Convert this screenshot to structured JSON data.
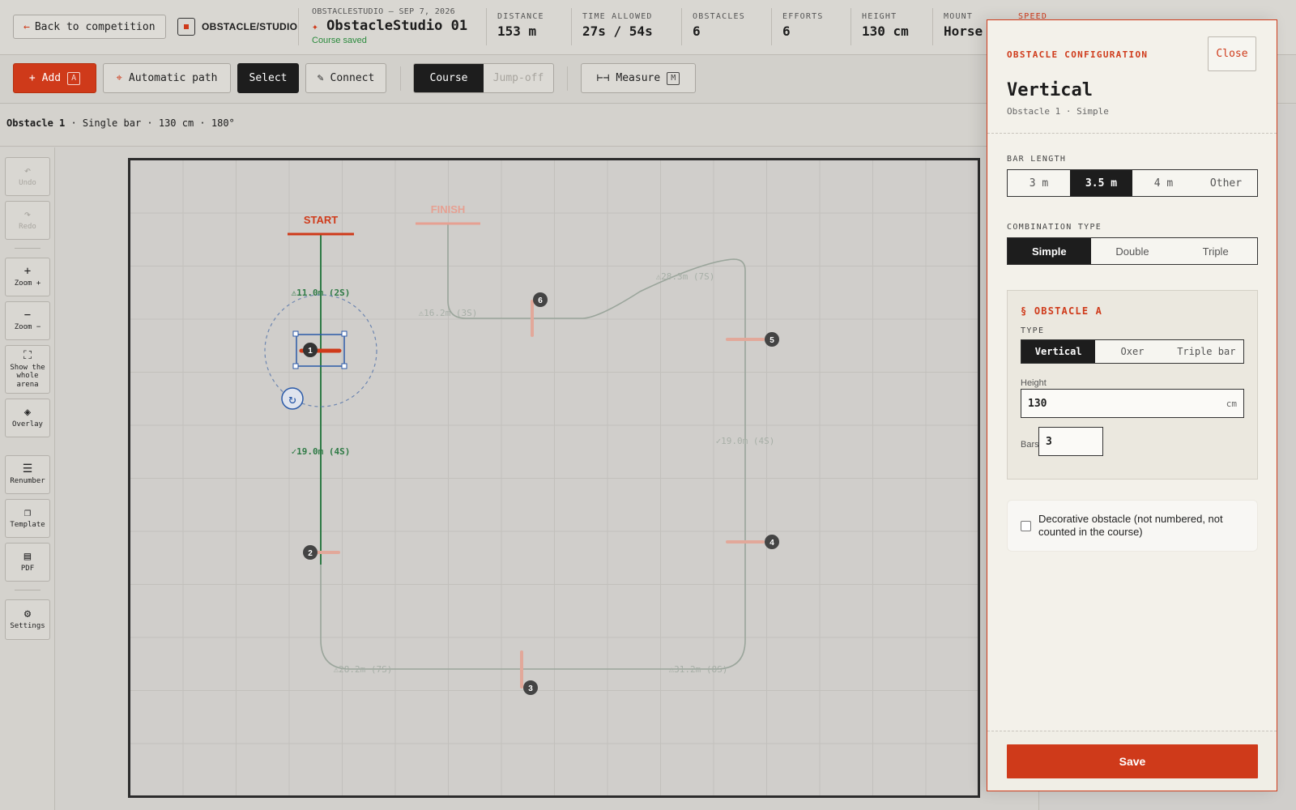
{
  "topbar": {
    "back_label": "Back to competition",
    "brand": "OBSTACLE/STUDIO",
    "course_kicker": "OBSTACLESTUDIO — SEP 7, 2026",
    "course_name": "ObstacleStudio 01",
    "course_status": "Course saved",
    "stats": [
      {
        "label": "DISTANCE",
        "value": "153 m"
      },
      {
        "label": "TIME ALLOWED",
        "value": "27s / 54s"
      },
      {
        "label": "OBSTACLES",
        "value": "6"
      },
      {
        "label": "EFFORTS",
        "value": "6"
      },
      {
        "label": "HEIGHT",
        "value": "130 cm"
      },
      {
        "label": "MOUNT",
        "value": "Horse"
      },
      {
        "label": "SPEED",
        "value": ""
      }
    ]
  },
  "toolbar": {
    "add_label": "Add",
    "add_key": "A",
    "auto_path_label": "Automatic path",
    "select_label": "Select",
    "connect_label": "Connect",
    "course_tab": "Course",
    "jumpoff_tab": "Jump-off",
    "measure_label": "Measure",
    "measure_key": "M"
  },
  "infobar": {
    "obstacle": "Obstacle 1",
    "details": " · Single bar · 130 cm · 180°"
  },
  "rail": {
    "undo": "Undo",
    "redo": "Redo",
    "zoom_in": "Zoom +",
    "zoom_out": "Zoom −",
    "show_arena": "Show the whole arena",
    "overlay": "Overlay",
    "renumber": "Renumber",
    "template": "Template",
    "pdf": "PDF",
    "settings": "Settings"
  },
  "arena": {
    "start_label": "START",
    "finish_label": "FINISH",
    "segments": [
      "⚠11.0m (2S)",
      "✓19.0m (4S)",
      "⚠28.2m (7S)",
      "⚠31.2m (8S)",
      "✓19.0m (4S)",
      "⚠28.3m (7S)",
      "⚠16.2m (3S)"
    ],
    "obstacles": [
      "1",
      "2",
      "3",
      "4",
      "5",
      "6"
    ]
  },
  "modal": {
    "kicker": "OBSTACLE CONFIGURATION",
    "close_label": "Close",
    "title": "Vertical",
    "subtitle": "Obstacle 1 · Simple",
    "bar_length_label": "BAR LENGTH",
    "bar_lengths": [
      "3 m",
      "3.5 m",
      "4 m",
      "Other"
    ],
    "bar_length_selected": "3.5 m",
    "combination_label": "COMBINATION TYPE",
    "combinations": [
      "Simple",
      "Double",
      "Triple"
    ],
    "combination_selected": "Simple",
    "obstacle_a_title": "§ OBSTACLE A",
    "type_label": "TYPE",
    "types": [
      "Vertical",
      "Oxer",
      "Triple bar"
    ],
    "type_selected": "Vertical",
    "height_label": "Height",
    "height_value": "130",
    "height_unit": "cm",
    "bars_label": "Bars",
    "bars_value": "3",
    "decorative_label": "Decorative obstacle (not numbered, not counted in the course)",
    "decorative_checked": false,
    "save_label": "Save"
  },
  "colors": {
    "accent": "#cf3a1a",
    "dark": "#1d1d1d",
    "ok": "#2a8a3c"
  }
}
